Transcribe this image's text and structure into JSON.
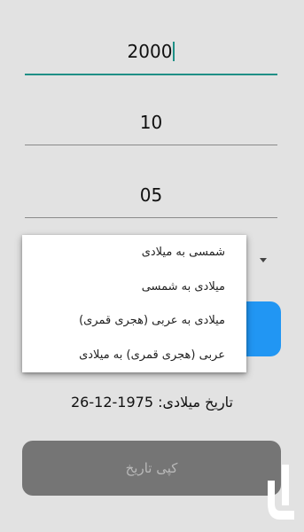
{
  "inputs": {
    "year": "2000",
    "month": "10",
    "day": "05"
  },
  "conversion_menu": {
    "items": [
      "شمسی به میلادی",
      "میلادی به شمسی",
      "میلادی به عربی (هجری قمری)",
      "عربی (هجری قمری) به میلادی"
    ]
  },
  "result": {
    "text": "تاریخ میلادی: 1975-12-26"
  },
  "copy_button": {
    "label": "کپی تاریخ"
  },
  "colors": {
    "background": "#e2e2e2",
    "accent": "#1f8f86",
    "primary_button": "#2196f3",
    "disabled_button": "#757575"
  },
  "icons": {
    "spinner": "dropdown-arrow-icon",
    "logo": "app-logo-icon"
  }
}
